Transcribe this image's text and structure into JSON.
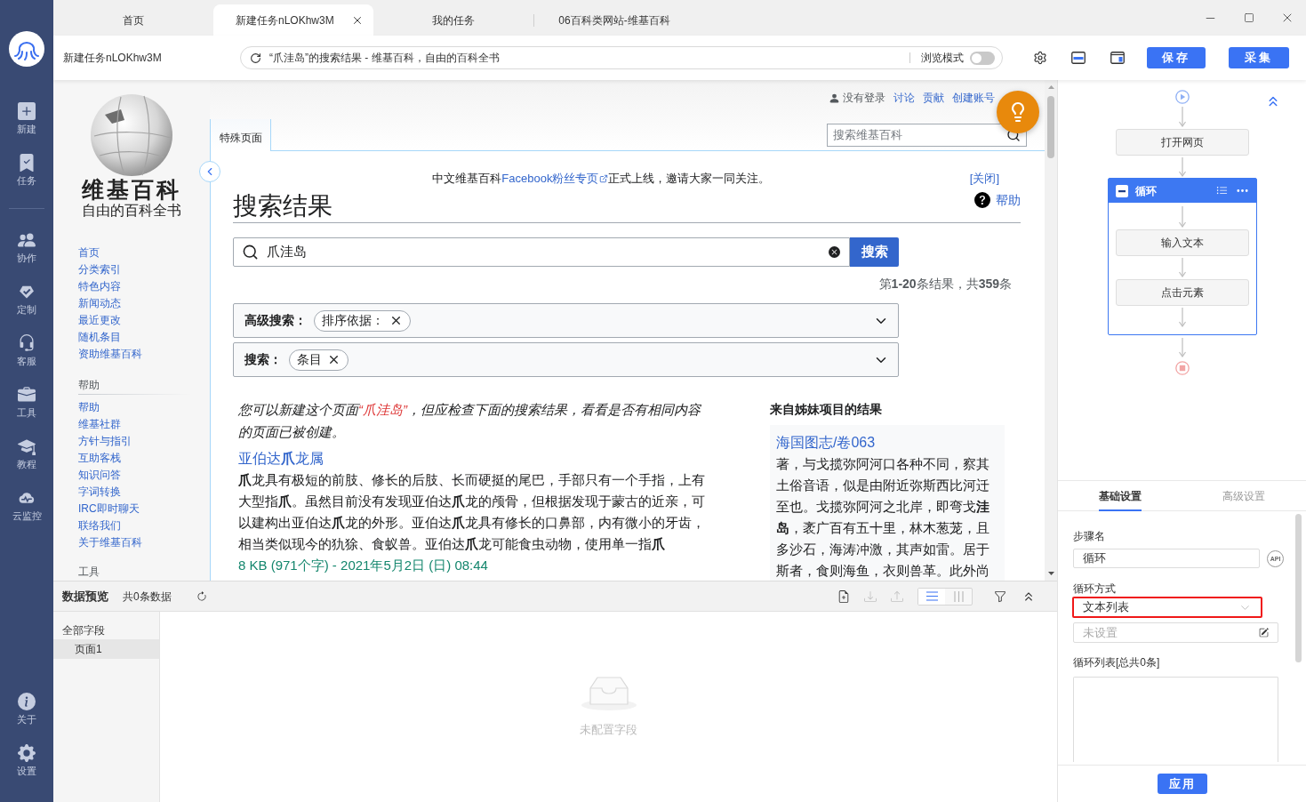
{
  "app_sidebar": {
    "groups": [
      [
        {
          "label": "新建"
        },
        {
          "label": "任务"
        }
      ],
      [
        {
          "label": "协作"
        },
        {
          "label": "定制"
        },
        {
          "label": "客服"
        },
        {
          "label": "工具"
        },
        {
          "label": "教程"
        },
        {
          "label": "云监控"
        }
      ]
    ],
    "bottom_items": [
      {
        "label": "关于"
      },
      {
        "label": "设置"
      }
    ]
  },
  "tabs": [
    {
      "label": "首页",
      "selected": false
    },
    {
      "label": "新建任务nLOKhw3M",
      "selected": true
    },
    {
      "label": "我的任务",
      "selected": false
    },
    {
      "label": "06百科类网站-维基百科",
      "selected": false
    }
  ],
  "address_bar": {
    "task_name": "新建任务nLOKhw3M",
    "page_title": "“爪洼岛”的搜索结果 - 维基百科，自由的百科全书",
    "browse_mode": {
      "label": "浏览模式",
      "on": false
    }
  },
  "action_buttons": [
    "保存",
    "采集"
  ],
  "webpage": {
    "logo": {
      "wordmark": "维基百科",
      "tagline": "自由的百科全书"
    },
    "nav_links": [
      "首页",
      "分类索引",
      "特色内容",
      "新闻动态",
      "最近更改",
      "随机条目",
      "资助维基百科"
    ],
    "portals": [
      {
        "heading": "帮助",
        "links": [
          "帮助",
          "维基社群",
          "方针与指引",
          "互助客栈",
          "知识问答",
          "字词转换",
          "IRC即时聊天",
          "联络我们",
          "关于维基百科"
        ]
      },
      {
        "heading": "工具"
      }
    ],
    "personal_tools": [
      {
        "label": "没有登录",
        "kind": "status"
      },
      {
        "label": "讨论",
        "kind": "link"
      },
      {
        "label": "贡献",
        "kind": "link"
      },
      {
        "label": "创建账号",
        "kind": "link"
      }
    ],
    "page_tab": "特殊页面",
    "search_placeholder": "搜索维基百科",
    "banner": {
      "before": "中文维基百科",
      "link": "Facebook粉丝专页",
      "after": "正式上线，邀请大家一同关注。",
      "close": "[关闭]"
    },
    "title": "搜索结果",
    "help_link": "帮助",
    "search": {
      "value": "爪洼岛",
      "button": "搜索"
    },
    "result_count": "第**1-20**条结果，共**359**条",
    "filters": [
      {
        "label": "高级搜索：",
        "chips": [
          "排序依据："
        ],
        "expanded": false
      },
      {
        "label": "搜索：",
        "chips": [
          "条目"
        ],
        "expanded": false
      }
    ],
    "create_notice": {
      "before": "您可以新建这个页面",
      "link": "“爪洼岛”",
      "after": "，但应检查下面的搜索结果，看看是否有相同内容的页面已被创建。"
    },
    "results": [
      {
        "title": "亚伯达**爪**龙属",
        "snippet": "**爪**龙具有极短的前肢、修长的后肢、长而硬挺的尾巴，手部只有一个手指，上有大型指**爪**。虽然目前没有发现亚伯达**爪**龙的颅骨，但根据发现于蒙古的近亲，可以建构出亚伯达**爪**龙的外形。亚伯达**爪**龙具有修长的口鼻部，内有微小的牙齿，相当类似现今的犰狳、食蚁兽。亚伯达**爪**龙可能食虫动物，使用单一指**爪**",
        "meta": "8 KB (971个字) - 2021年5月2日 (日) 08:44"
      }
    ],
    "sister_results": {
      "heading": "来自姊妹项目的结果",
      "items": [
        {
          "title": "海国图志/卷063",
          "snippet": "著，与戈揽弥阿河口各种不同，察其土俗音语，似是由附近弥斯西比河迁至也。戈揽弥阿河之北岸，即弯戈**洼岛**，袤广百有五十里，林木葱茏，且多沙石，海涛冲激，其声如雷。居于斯者，食则海鱼，衣则兽革。此外尚"
        }
      ]
    }
  },
  "data_preview": {
    "title": "数据预览",
    "count": "共0条数据",
    "actions": [
      {
        "disabled": false
      },
      {
        "disabled": true
      },
      {
        "disabled": true
      }
    ],
    "view_modes": [
      {
        "selected": true
      },
      {
        "selected": false
      }
    ],
    "field_list": {
      "heading": "全部字段",
      "items": [
        {
          "label": "页面1",
          "selected": true
        }
      ]
    },
    "empty_text": "未配置字段"
  },
  "workflow": {
    "steps": [
      {
        "kind": "step",
        "label": "打开网页"
      },
      {
        "kind": "loop",
        "label": "循环",
        "children": [
          {
            "kind": "step",
            "label": "输入文本"
          },
          {
            "kind": "step",
            "label": "点击元素"
          }
        ]
      }
    ]
  },
  "settings_tabs": [
    {
      "label": "基础设置",
      "selected": true
    },
    {
      "label": "高级设置",
      "selected": false
    }
  ],
  "settings_form": {
    "step_name": {
      "label": "步骤名",
      "value": "循环",
      "badge": "API"
    },
    "loop_mode": {
      "label": "循环方式",
      "value": "文本列表",
      "highlighted": true
    },
    "loop_source": {
      "placeholder": "未设置"
    },
    "loop_list": {
      "label": "循环列表[总共0条]"
    }
  },
  "apply_button": "应用"
}
